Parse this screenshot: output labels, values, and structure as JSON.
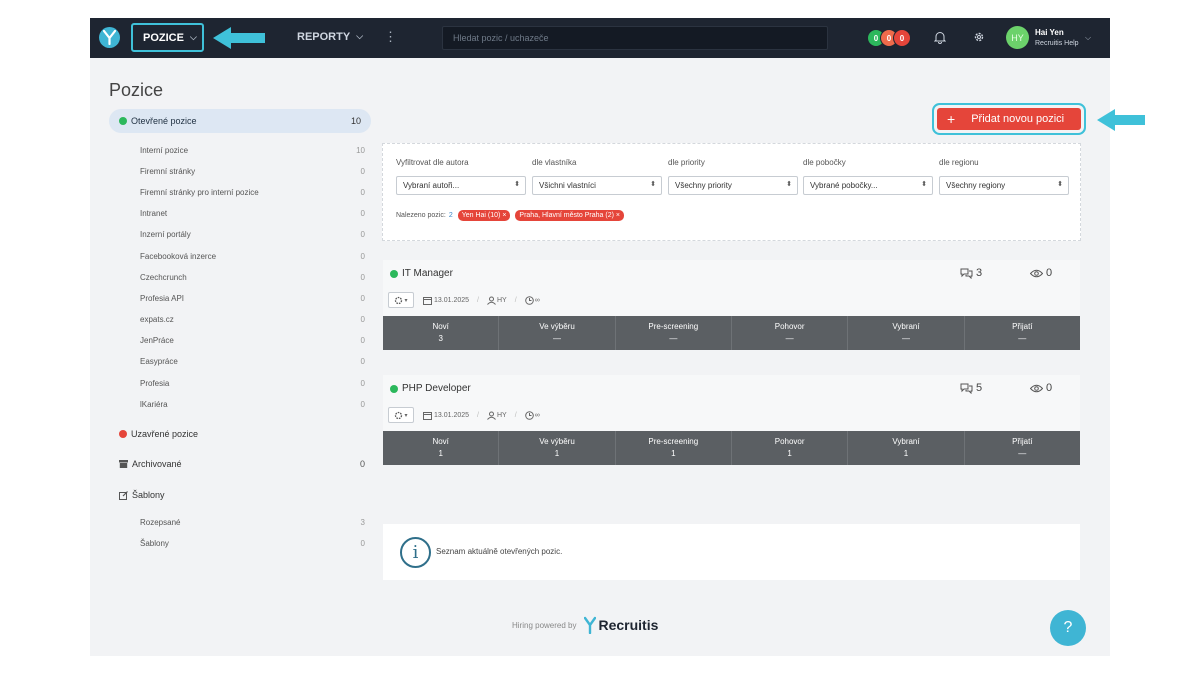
{
  "topbar": {
    "nav_pozice": "POZICE",
    "nav_hidden": "",
    "nav_reporty": "REPORTY",
    "search_placeholder": "Hledat pozic / uchazeče",
    "badges": [
      "0",
      "0",
      "0"
    ],
    "user_initials": "HY",
    "user_name": "Hai Yen",
    "user_org": "Recruitis Help"
  },
  "sidebar": {
    "title": "Pozice",
    "open": {
      "label": "Otevřené pozice",
      "count": "10"
    },
    "channels": [
      {
        "label": "Interní pozice",
        "count": "10"
      },
      {
        "label": "Firemní stránky",
        "count": "0"
      },
      {
        "label": "Firemní stránky pro interní pozice",
        "count": "0"
      },
      {
        "label": "Intranet",
        "count": "0"
      },
      {
        "label": "Inzerní portály",
        "count": "0"
      },
      {
        "label": "Facebooková inzerce",
        "count": "0"
      },
      {
        "label": "Czechcrunch",
        "count": "0"
      },
      {
        "label": "Profesia API",
        "count": "0"
      },
      {
        "label": "expats.cz",
        "count": "0"
      },
      {
        "label": "JenPráce",
        "count": "0"
      },
      {
        "label": "Easypráce",
        "count": "0"
      },
      {
        "label": "Profesia",
        "count": "0"
      },
      {
        "label": "lKariéra",
        "count": "0"
      }
    ],
    "closed": {
      "label": "Uzavřené pozice"
    },
    "archived": {
      "label": "Archivované",
      "count": "0"
    },
    "templates": {
      "label": "Šablony"
    },
    "template_items": [
      {
        "label": "Rozepsané",
        "count": "3"
      },
      {
        "label": "Šablony",
        "count": "0"
      }
    ]
  },
  "add_button": {
    "plus": "+",
    "label": "Přidat novou pozici"
  },
  "filter": {
    "author_label": "Vyfiltrovat dle autora",
    "author_value": "Vybraní autoři...",
    "owner_label": "dle vlastníka",
    "owner_value": "Všichni vlastníci",
    "priority_label": "dle priority",
    "priority_value": "Všechny priority",
    "branch_label": "dle pobočky",
    "branch_value": "Vybrané pobočky...",
    "region_label": "dle regionu",
    "region_value": "Všechny regiony",
    "found_label": "Nalezeno pozic:",
    "found_count": "2",
    "tags": [
      "Yen Hai (10) ×",
      "Praha, Hlavní město Praha (2) ×"
    ]
  },
  "jobs": [
    {
      "title": "IT Manager",
      "comments": "3",
      "views": "0",
      "date": "13.01.2025",
      "owner": "HY",
      "duration": "∞",
      "stages": [
        {
          "label": "Noví",
          "value": "3"
        },
        {
          "label": "Ve výběru",
          "value": "—"
        },
        {
          "label": "Pre-screening",
          "value": "—"
        },
        {
          "label": "Pohovor",
          "value": "—"
        },
        {
          "label": "Vybraní",
          "value": "—"
        },
        {
          "label": "Přijatí",
          "value": "—"
        }
      ]
    },
    {
      "title": "PHP Developer",
      "comments": "5",
      "views": "0",
      "date": "13.01.2025",
      "owner": "HY",
      "duration": "∞",
      "stages": [
        {
          "label": "Noví",
          "value": "1"
        },
        {
          "label": "Ve výběru",
          "value": "1"
        },
        {
          "label": "Pre-screening",
          "value": "1"
        },
        {
          "label": "Pohovor",
          "value": "1"
        },
        {
          "label": "Vybraní",
          "value": "1"
        },
        {
          "label": "Přijatí",
          "value": "—"
        }
      ]
    }
  ],
  "info": {
    "icon": "i",
    "text": "Seznam aktuálně otevřených pozic."
  },
  "footer": {
    "text": "Hiring powered by",
    "brand": "Recruitis"
  },
  "help": {
    "label": "?"
  }
}
